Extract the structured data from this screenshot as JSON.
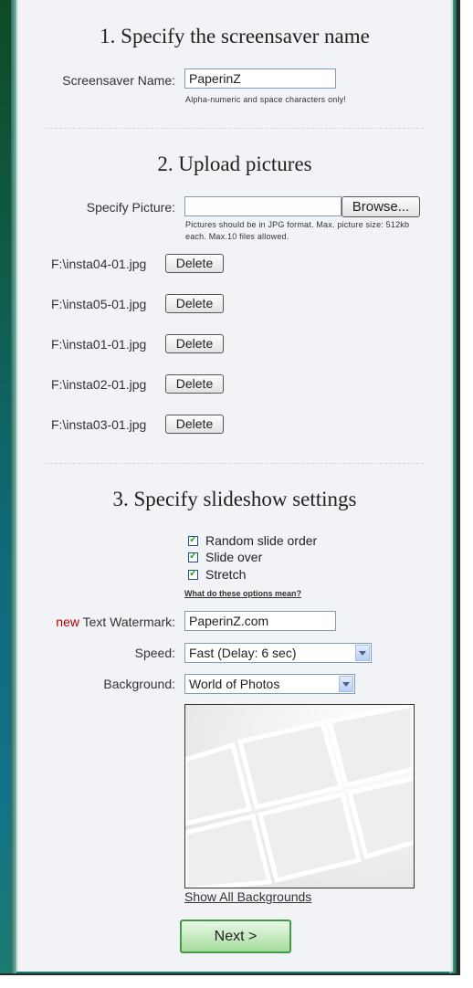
{
  "step1": {
    "title": "1. Specify the screensaver name",
    "name_label": "Screensaver Name:",
    "name_value": "PaperinZ",
    "hint": "Alpha-numeric and space characters only!"
  },
  "step2": {
    "title": "2. Upload pictures",
    "picture_label": "Specify Picture:",
    "picture_value": "",
    "browse_label": "Browse...",
    "hint_line1": "Pictures should be in JPG format. Max. picture size: 512kb",
    "hint_line2": "each. Max.10 files allowed.",
    "delete_label": "Delete",
    "files": [
      "F:\\insta04-01.jpg",
      "F:\\insta05-01.jpg",
      "F:\\insta01-01.jpg",
      "F:\\insta02-01.jpg",
      "F:\\insta03-01.jpg"
    ]
  },
  "step3": {
    "title": "3. Specify slideshow settings",
    "options": [
      {
        "label": "Random slide order",
        "checked": true
      },
      {
        "label": "Slide over",
        "checked": true
      },
      {
        "label": "Stretch",
        "checked": true
      }
    ],
    "options_help_link": "What do these options mean?",
    "watermark_new": "new",
    "watermark_label": " Text Watermark:",
    "watermark_value": "PaperinZ.com",
    "speed_label": "Speed:",
    "speed_value": "Fast (Delay: 6 sec)",
    "background_label": "Background:",
    "background_value": "World of Photos",
    "show_all_link": "Show All Backgrounds",
    "next_label": "Next >"
  },
  "colors": {
    "panel_bg": "#f1f3f6",
    "new_badge": "#b00000",
    "next_button_border": "#3f9d45",
    "checkbox_tick": "#21a121"
  },
  "icons": {
    "checkbox": "checkmark-icon",
    "dropdown": "chevron-down-icon"
  }
}
